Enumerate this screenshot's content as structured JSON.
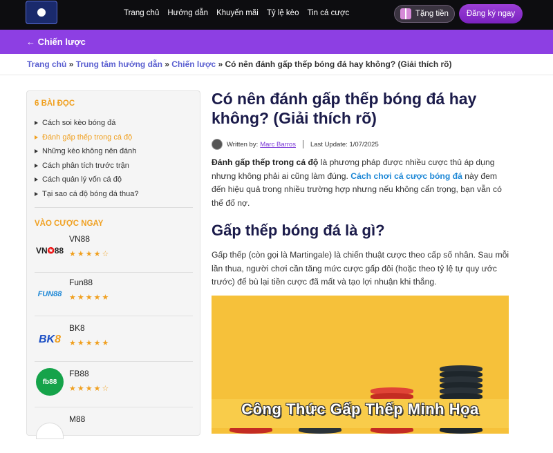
{
  "header": {
    "nav": [
      "Trang chủ",
      "Hướng dẫn",
      "Khuyến mãi",
      "Tỷ lệ kèo",
      "Tin cá cược"
    ],
    "gift_label": "Tặng tiền",
    "register_label": "Đăng ký ngay"
  },
  "band": {
    "back_label": "← Chiến lược"
  },
  "breadcrumb": {
    "home": "Trang chủ",
    "sep1": " » ",
    "guide": "Trung tâm hướng dẫn",
    "sep2": " » ",
    "category": "Chiến lược",
    "sep3": " » ",
    "current": "Có nên đánh gấp thếp bóng đá hay không? (Giải thích rõ)"
  },
  "sidebar": {
    "toc_title": "6 BÀI ĐỌC",
    "toc": [
      {
        "label": "Cách soi kèo bóng đá",
        "active": false
      },
      {
        "label": "Đánh gấp thếp trong cá độ",
        "active": true
      },
      {
        "label": "Những kèo không nên đánh",
        "active": false
      },
      {
        "label": "Cách phân tích trước trận",
        "active": false
      },
      {
        "label": "Cách quản lý vốn cá độ",
        "active": false
      },
      {
        "label": "Tại sao cá độ bóng đá thua?",
        "active": false
      }
    ],
    "bet_title": "VÀO CƯỢC NGAY",
    "bookmakers": [
      {
        "name": "VN88",
        "stars": "★★★★☆",
        "rating": 4
      },
      {
        "name": "Fun88",
        "stars": "★★★★★",
        "rating": 5
      },
      {
        "name": "BK8",
        "stars": "★★★★★",
        "rating": 5
      },
      {
        "name": "FB88",
        "stars": "★★★★☆",
        "rating": 4
      },
      {
        "name": "M88",
        "stars": "",
        "rating": null
      }
    ],
    "logos": {
      "vn_a": "VN",
      "vn_b": "✪",
      "vn_c": "88",
      "fun": "FUN88",
      "bk_a": "BK",
      "bk_b": "8",
      "fb": "fb88"
    }
  },
  "article": {
    "title": "Có nên đánh gấp thếp bóng đá hay không? (Giải thích rõ)",
    "written_by": "Written by:",
    "author": "Marc Barros",
    "last_update": "Last Update: 1/07/2025",
    "intro_bold": "Đánh gấp thếp trong cá độ",
    "intro_1": " là phương pháp được nhiều cược thủ áp dụng nhưng không phải ai cũng làm đúng. ",
    "intro_link": "Cách chơi cá cược bóng đá",
    "intro_2": " này đem đến hiệu quả trong nhiều trường hợp nhưng nếu không cẩn trọng, bạn vẫn có thể đổ nợ.",
    "h2": "Gấp thếp bóng đá là gì?",
    "para2": "Gấp thếp (còn gọi là Martingale) là chiến thuật cược theo cấp số nhân. Sau mỗi lần thua, người chơi cần tăng mức cược gấp đôi (hoặc theo tỷ lệ tự quy ước trước) để bù lại tiền cược đã mất và tạo lợi nhuận khi thắng.",
    "banner_text": "Công Thức Gấp Thếp Minh Họa"
  },
  "colors": {
    "accent": "#8d3fe3",
    "orange": "#f0a020",
    "link": "#1e88d6",
    "title": "#1b1b4a"
  }
}
